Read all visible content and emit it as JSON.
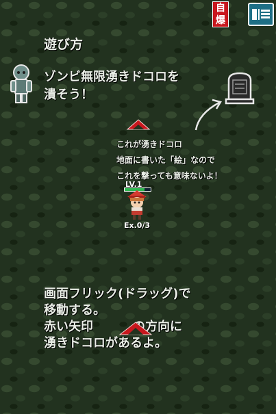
{
  "hud": {
    "self_destruct_label": "自爆",
    "menu_icon": "menu-icon"
  },
  "tutorial": {
    "title": "遊び方",
    "zombie_line1": "ゾンビ無限湧きドコロを",
    "zombie_line2": "潰そう！",
    "spawn_line1": "これが湧きドコロ",
    "spawn_line2": "地面に書いた「絵」なので",
    "spawn_line3": "これを撃っても意味ないよ！",
    "howto_line1": "画面フリック(ドラッグ)で",
    "howto_line2": "移動する。",
    "howto_line3a": "赤い矢印",
    "howto_line3b": "の方向に",
    "howto_line4": "湧きドコロがあるよ。"
  },
  "player": {
    "level": "LV.1",
    "level_progress": 0.75,
    "exp": "Ex.0/3"
  },
  "colors": {
    "accent_red": "#c8171e",
    "menu_blue": "#1e6f86",
    "level_green": "#2fb850"
  }
}
